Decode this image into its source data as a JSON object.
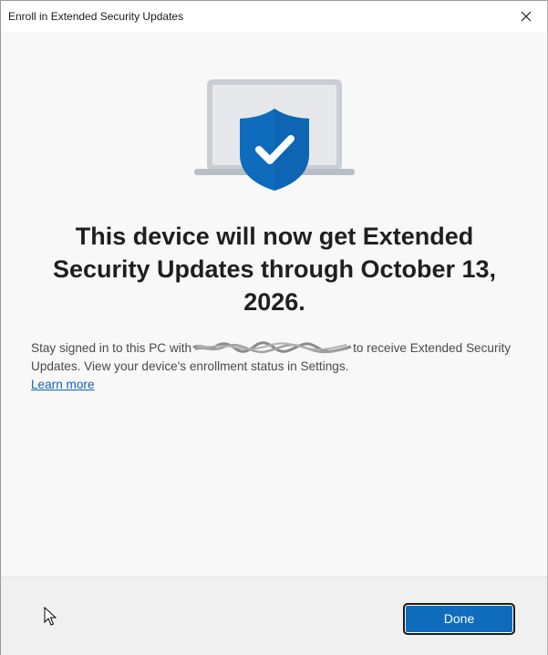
{
  "window": {
    "title": "Enroll in Extended Security Updates"
  },
  "hero": {
    "icon": "laptop-shield-check-icon",
    "accent_color": "#0f6cbd"
  },
  "main": {
    "headline": "This device will now get Extended Security Updates through October 13, 2026.",
    "body_prefix": "Stay signed in to this PC with",
    "body_suffix": "to receive Extended Security Updates. View your device's enrollment status in Settings.",
    "learn_more_label": "Learn more"
  },
  "footer": {
    "done_label": "Done"
  }
}
